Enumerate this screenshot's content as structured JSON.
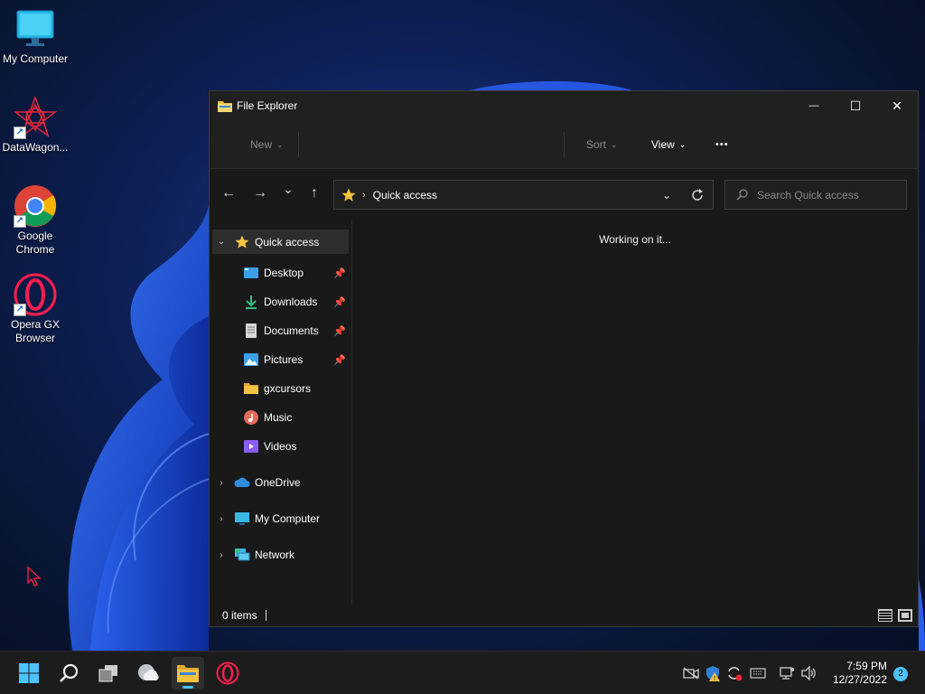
{
  "desktop": {
    "icons": [
      {
        "label": "My Computer",
        "icon": "monitor-icon"
      },
      {
        "label": "DataWagon...",
        "icon": "datawagon-icon"
      },
      {
        "label": "Google Chrome",
        "icon": "chrome-icon"
      },
      {
        "label": "Opera GX Browser",
        "icon": "opera-gx-icon"
      }
    ]
  },
  "window": {
    "title": "File Explorer",
    "controls": {
      "minimize": "—",
      "maximize": "☐",
      "close": "✕"
    },
    "commandbar": {
      "new_label": "New",
      "sort_label": "Sort",
      "view_label": "View",
      "more_label": "•••"
    },
    "nav": {
      "back": "←",
      "forward": "→",
      "recent": "⌄",
      "up": "↑"
    },
    "address": {
      "crumb": "Quick access"
    },
    "search": {
      "placeholder": "Search Quick access"
    },
    "navpane": {
      "quick_access": "Quick access",
      "items": [
        {
          "label": "Desktop",
          "pinned": true
        },
        {
          "label": "Downloads",
          "pinned": true
        },
        {
          "label": "Documents",
          "pinned": true
        },
        {
          "label": "Pictures",
          "pinned": true
        },
        {
          "label": "gxcursors",
          "pinned": false
        },
        {
          "label": "Music",
          "pinned": false
        },
        {
          "label": "Videos",
          "pinned": false
        }
      ],
      "roots": [
        {
          "label": "OneDrive"
        },
        {
          "label": "My Computer"
        },
        {
          "label": "Network"
        }
      ]
    },
    "main": {
      "status_message": "Working on it..."
    },
    "statusbar": {
      "items_count": "0 items"
    }
  },
  "taskbar": {
    "apps": [
      "start-icon",
      "search-icon",
      "task-view-icon",
      "widgets-icon",
      "file-explorer-icon",
      "opera-gx-icon"
    ],
    "clock": {
      "time": "7:59 PM",
      "date": "12/27/2022"
    },
    "notifications_count": "2"
  },
  "colors": {
    "accent": "#4cc2ff",
    "window_bg": "#191919",
    "titlebar_bg": "#202020",
    "folder_yellow": "#f5c242"
  }
}
